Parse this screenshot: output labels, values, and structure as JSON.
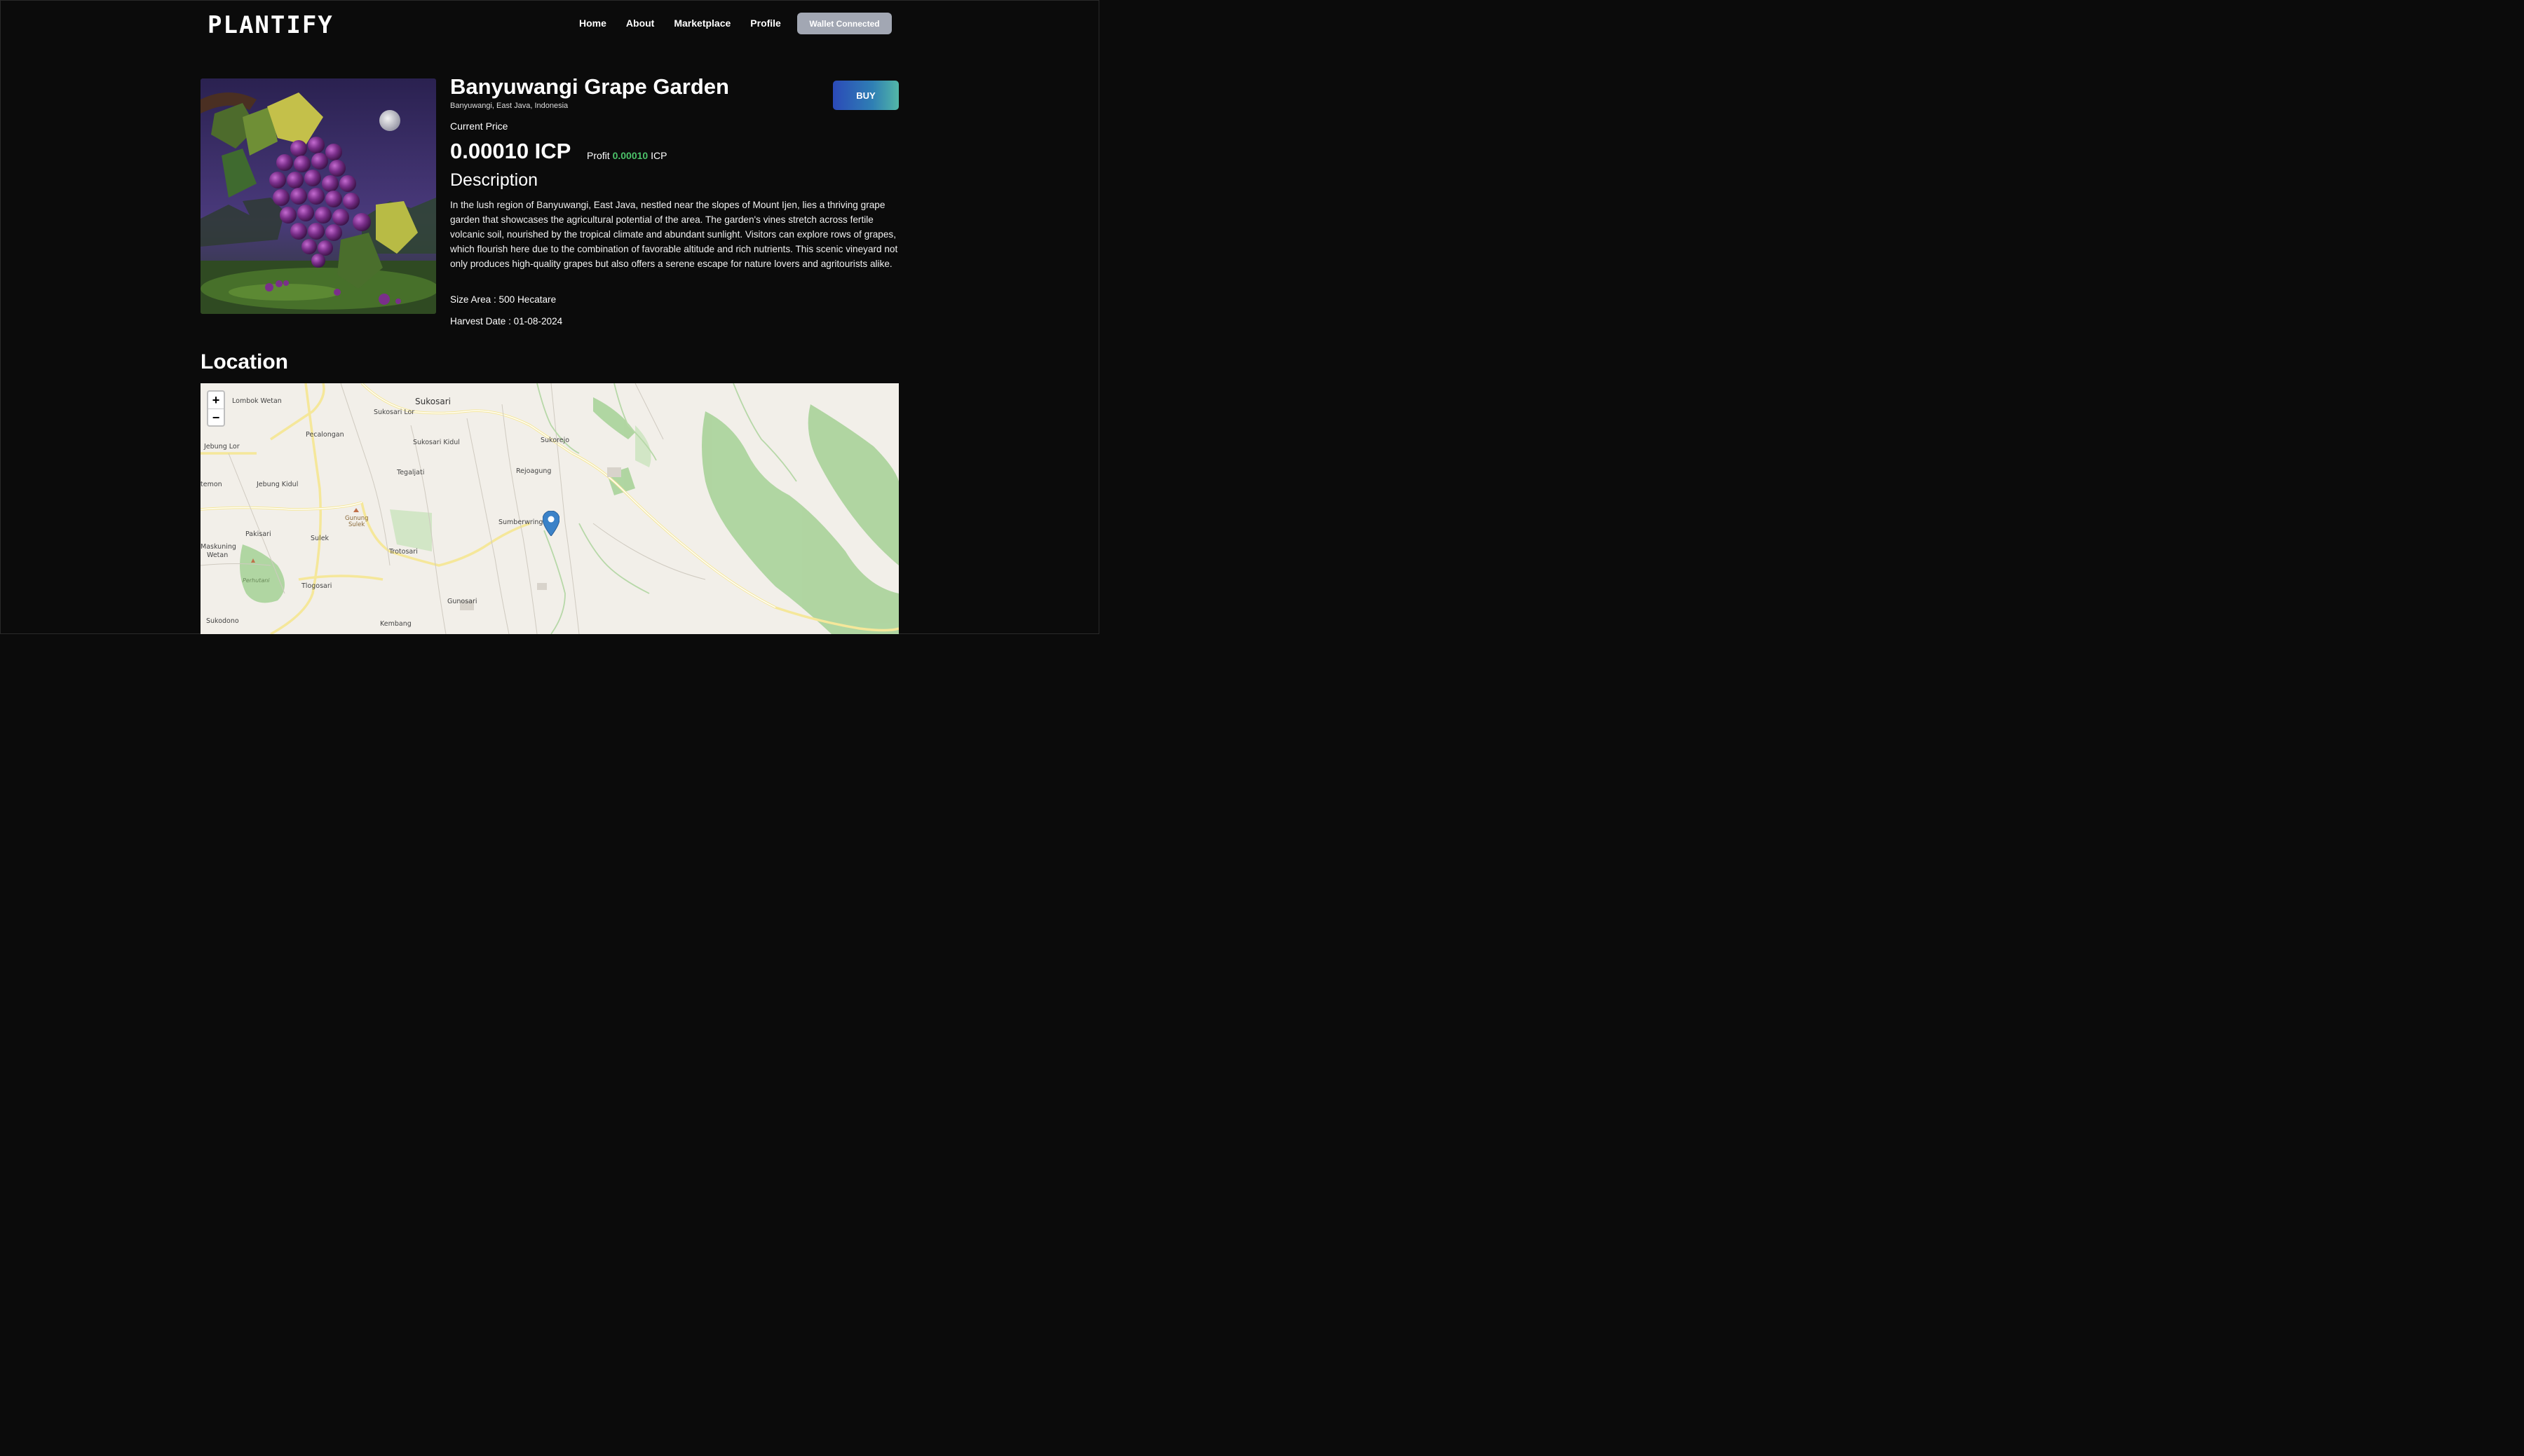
{
  "app": {
    "logo": "PLANTIFY"
  },
  "nav": {
    "items": [
      "Home",
      "About",
      "Marketplace",
      "Profile"
    ],
    "wallet_label": "Wallet Connected"
  },
  "product": {
    "title": "Banyuwangi Grape Garden",
    "location": "Banyuwangi, East Java, Indonesia",
    "buy_label": "BUY",
    "current_price_label": "Current Price",
    "price": "0.00010 ICP",
    "profit_label": "Profit",
    "profit_value": "0.00010",
    "profit_unit": "ICP",
    "description_title": "Description",
    "description": "In the lush region of Banyuwangi, East Java, nestled near the slopes of Mount Ijen, lies a thriving grape garden that showcases the agricultural potential of the area. The garden's vines stretch across fertile volcanic soil, nourished by the tropical climate and abundant sunlight. Visitors can explore rows of grapes, which flourish here due to the combination of favorable altitude and rich nutrients. This scenic vineyard not only produces high-quality grapes but also offers a serene escape for nature lovers and agritourists alike.",
    "size_area": "Size Area : 500 Hecatare",
    "harvest_date": "Harvest Date : 01-08-2024"
  },
  "location_section": {
    "title": "Location",
    "zoom_in": "+",
    "zoom_out": "−",
    "place_labels": [
      "Lombok Wetan",
      "Sukosari",
      "Sukosari Lor",
      "Pecalongan",
      "Jebung Lor",
      "Sukosari Kidul",
      "Sukorejo",
      "Tegaljati",
      "Rejoagung",
      "temon",
      "Jebung Kidul",
      "Gunung",
      "Sulek",
      "Sumberwringin",
      "Pakisari",
      "Sulek",
      "Maskuning",
      "Wetan",
      "Trotosari",
      "Perhutani",
      "Tlogosari",
      "Gunosari",
      "Sukodono",
      "Kembang"
    ]
  },
  "colors": {
    "background": "#0b0b0b",
    "accent_green": "#4cc26a",
    "wallet_button": "#a2a7b3",
    "buy_gradient_start": "#2b4ab8",
    "buy_gradient_end": "#53b7a7",
    "map_bg": "#f2efe9",
    "forest": "#a9d39a"
  },
  "icons": {
    "map_pin": "map-marker-icon"
  }
}
